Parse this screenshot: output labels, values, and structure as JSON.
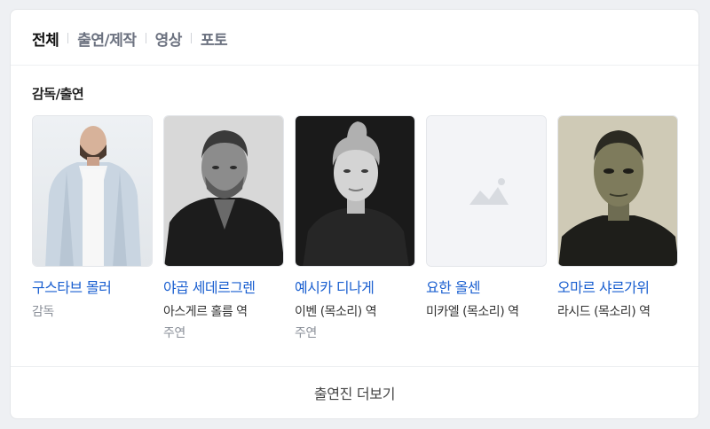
{
  "tabs": [
    {
      "label": "전체",
      "active": true
    },
    {
      "label": "출연/제작",
      "active": false
    },
    {
      "label": "영상",
      "active": false
    },
    {
      "label": "포토",
      "active": false
    }
  ],
  "section_title": "감독/출연",
  "people": [
    {
      "name": "구스타브 몰러",
      "role": "감독",
      "sub": "",
      "photo": "man-white-jacket"
    },
    {
      "name": "야곱 세데르그렌",
      "role": "아스게르 홀름 역",
      "sub": "주연",
      "photo": "man-bw-portrait"
    },
    {
      "name": "예시카 디나게",
      "role": "이벤 (목소리) 역",
      "sub": "주연",
      "photo": "woman-bw-portrait"
    },
    {
      "name": "요한 올센",
      "role": "미카엘 (목소리) 역",
      "sub": "",
      "photo": "placeholder-image-icon"
    },
    {
      "name": "오마르 샤르가위",
      "role": "라시드 (목소리) 역",
      "sub": "",
      "photo": "man-sepia-portrait"
    }
  ],
  "more_button": "출연진 더보기",
  "colors": {
    "link": "#1a5fd0",
    "active_tab": "#111111",
    "inactive_tab": "#6c7280"
  }
}
